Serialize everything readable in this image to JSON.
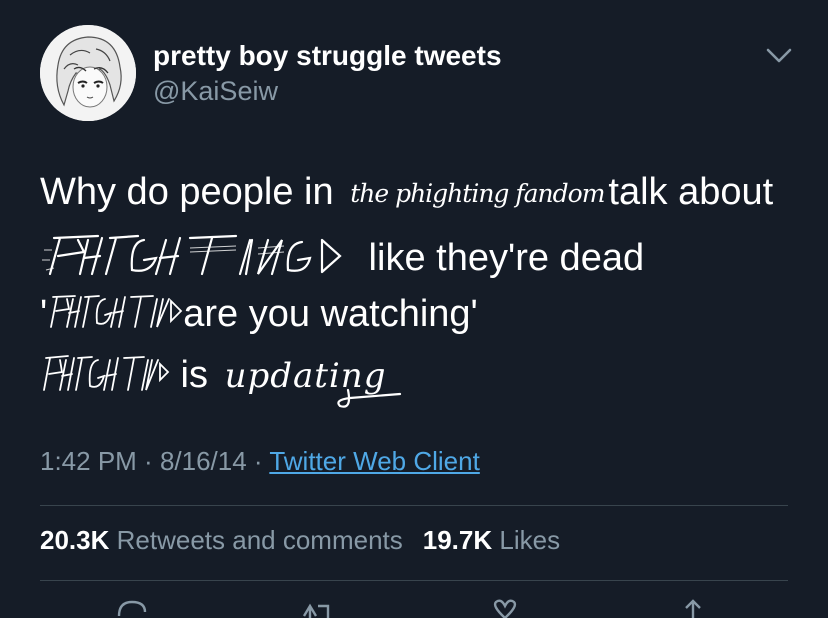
{
  "user": {
    "display_name": "pretty boy struggle tweets",
    "handle": "@KaiSeiw"
  },
  "tweet": {
    "line1_prefix": "Why do people in ",
    "line1_hand": "the phighting fandom",
    "line1_suffix": "talk about",
    "logo_word": "PHIGHTING!",
    "line2_suffix": " like they're dead",
    "line3_prefix": "'",
    "line3_suffix": "are you watching'",
    "line4_suffix": " is ",
    "line4_hand": "updating"
  },
  "meta": {
    "time": "1:42 PM",
    "sep1": " · ",
    "date": "8/16/14",
    "sep2": " · ",
    "client": "Twitter Web Client"
  },
  "stats": {
    "retweets_count": "20.3K",
    "retweets_label": "Retweets and comments",
    "likes_count": "19.7K",
    "likes_label": "Likes"
  },
  "icons": {
    "menu": "chevron-down-icon",
    "reply": "reply-icon",
    "retweet": "retweet-icon",
    "like": "heart-icon",
    "share": "share-icon"
  },
  "colors": {
    "background": "#151c27",
    "secondary_text": "#8899a6",
    "link": "#4fa8e6",
    "divider": "#38444d"
  }
}
